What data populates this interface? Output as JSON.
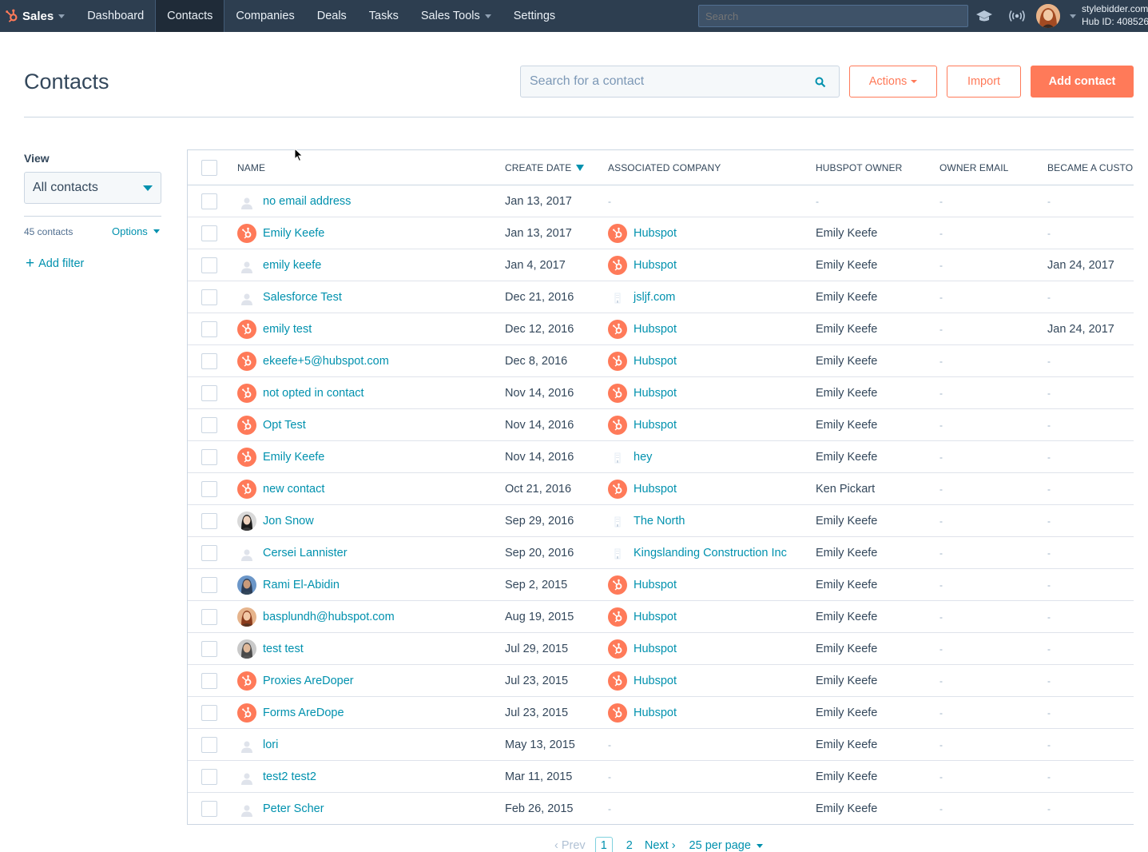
{
  "nav": {
    "brand": "Sales",
    "items": [
      "Dashboard",
      "Contacts",
      "Companies",
      "Deals",
      "Tasks",
      "Sales Tools",
      "Settings"
    ],
    "active_index": 1,
    "search_placeholder": "Search",
    "account_name": "stylebidder.com",
    "hub_id": "Hub ID: 408526"
  },
  "header": {
    "title": "Contacts",
    "search_placeholder": "Search for a contact",
    "actions_label": "Actions",
    "import_label": "Import",
    "add_label": "Add contact"
  },
  "sidebar": {
    "view_label": "View",
    "view_selected": "All contacts",
    "count": "45 contacts",
    "options_label": "Options",
    "add_filter_label": "Add filter"
  },
  "table": {
    "columns": [
      "NAME",
      "CREATE DATE",
      "ASSOCIATED COMPANY",
      "HUBSPOT OWNER",
      "OWNER EMAIL",
      "BECAME A CUSTOMER"
    ],
    "sorted_column": "CREATE DATE",
    "rows": [
      {
        "name": "no email address",
        "avatar": "person-placeholder",
        "date": "Jan 13, 2017",
        "company": "-",
        "company_icon": "none",
        "owner": "-",
        "email": "-",
        "became": "-"
      },
      {
        "name": "Emily Keefe",
        "avatar": "hubspot",
        "date": "Jan 13, 2017",
        "company": "Hubspot",
        "company_icon": "hubspot",
        "owner": "Emily Keefe",
        "email": "-",
        "became": "-"
      },
      {
        "name": "emily keefe",
        "avatar": "person-placeholder",
        "date": "Jan 4, 2017",
        "company": "Hubspot",
        "company_icon": "hubspot",
        "owner": "Emily Keefe",
        "email": "-",
        "became": "Jan 24, 2017"
      },
      {
        "name": "Salesforce Test",
        "avatar": "person-placeholder",
        "date": "Dec 21, 2016",
        "company": "jsljf.com",
        "company_icon": "building",
        "owner": "Emily Keefe",
        "email": "-",
        "became": "-"
      },
      {
        "name": "emily test",
        "avatar": "hubspot",
        "date": "Dec 12, 2016",
        "company": "Hubspot",
        "company_icon": "hubspot",
        "owner": "Emily Keefe",
        "email": "-",
        "became": "Jan 24, 2017"
      },
      {
        "name": "ekeefe+5@hubspot.com",
        "avatar": "hubspot",
        "date": "Dec 8, 2016",
        "company": "Hubspot",
        "company_icon": "hubspot",
        "owner": "Emily Keefe",
        "email": "-",
        "became": "-"
      },
      {
        "name": "not opted in contact",
        "avatar": "hubspot",
        "date": "Nov 14, 2016",
        "company": "Hubspot",
        "company_icon": "hubspot",
        "owner": "Emily Keefe",
        "email": "-",
        "became": "-"
      },
      {
        "name": "Opt Test",
        "avatar": "hubspot",
        "date": "Nov 14, 2016",
        "company": "Hubspot",
        "company_icon": "hubspot",
        "owner": "Emily Keefe",
        "email": "-",
        "became": "-"
      },
      {
        "name": "Emily Keefe",
        "avatar": "hubspot",
        "date": "Nov 14, 2016",
        "company": "hey",
        "company_icon": "building",
        "owner": "Emily Keefe",
        "email": "-",
        "became": "-"
      },
      {
        "name": "new contact",
        "avatar": "hubspot",
        "date": "Oct 21, 2016",
        "company": "Hubspot",
        "company_icon": "hubspot",
        "owner": "Ken Pickart",
        "email": "-",
        "became": "-"
      },
      {
        "name": "Jon Snow",
        "avatar": "photo-dark",
        "date": "Sep 29, 2016",
        "company": "The North",
        "company_icon": "building",
        "owner": "Emily Keefe",
        "email": "-",
        "became": "-"
      },
      {
        "name": "Cersei Lannister",
        "avatar": "person-placeholder",
        "date": "Sep 20, 2016",
        "company": "Kingslanding Construction Inc",
        "company_icon": "building",
        "owner": "Emily Keefe",
        "email": "-",
        "became": "-"
      },
      {
        "name": "Rami El-Abidin",
        "avatar": "photo-blue",
        "date": "Sep 2, 2015",
        "company": "Hubspot",
        "company_icon": "hubspot",
        "owner": "Emily Keefe",
        "email": "-",
        "became": "-"
      },
      {
        "name": "basplundh@hubspot.com",
        "avatar": "photo-warm",
        "date": "Aug 19, 2015",
        "company": "Hubspot",
        "company_icon": "hubspot",
        "owner": "Emily Keefe",
        "email": "-",
        "became": "-"
      },
      {
        "name": "test test",
        "avatar": "photo-gray",
        "date": "Jul 29, 2015",
        "company": "Hubspot",
        "company_icon": "hubspot",
        "owner": "Emily Keefe",
        "email": "-",
        "became": "-"
      },
      {
        "name": "Proxies AreDoper",
        "avatar": "hubspot",
        "date": "Jul 23, 2015",
        "company": "Hubspot",
        "company_icon": "hubspot",
        "owner": "Emily Keefe",
        "email": "-",
        "became": "-"
      },
      {
        "name": "Forms AreDope",
        "avatar": "hubspot",
        "date": "Jul 23, 2015",
        "company": "Hubspot",
        "company_icon": "hubspot",
        "owner": "Emily Keefe",
        "email": "-",
        "became": "-"
      },
      {
        "name": "lori",
        "avatar": "person-placeholder",
        "date": "May 13, 2015",
        "company": "-",
        "company_icon": "none",
        "owner": "Emily Keefe",
        "email": "-",
        "became": "-"
      },
      {
        "name": "test2 test2",
        "avatar": "person-placeholder",
        "date": "Mar 11, 2015",
        "company": "-",
        "company_icon": "none",
        "owner": "Emily Keefe",
        "email": "-",
        "became": "-"
      },
      {
        "name": "Peter Scher",
        "avatar": "person-placeholder",
        "date": "Feb 26, 2015",
        "company": "-",
        "company_icon": "none",
        "owner": "Emily Keefe",
        "email": "-",
        "became": "-"
      }
    ]
  },
  "pagination": {
    "prev_label": "Prev",
    "current_page": "1",
    "next_page": "2",
    "next_label": "Next",
    "per_page": "25 per page"
  },
  "colors": {
    "nav_bg": "#2d3e50",
    "accent_orange": "#ff7a59",
    "link_teal": "#0091ae",
    "text": "#33475b",
    "border": "#cbd6e2"
  }
}
